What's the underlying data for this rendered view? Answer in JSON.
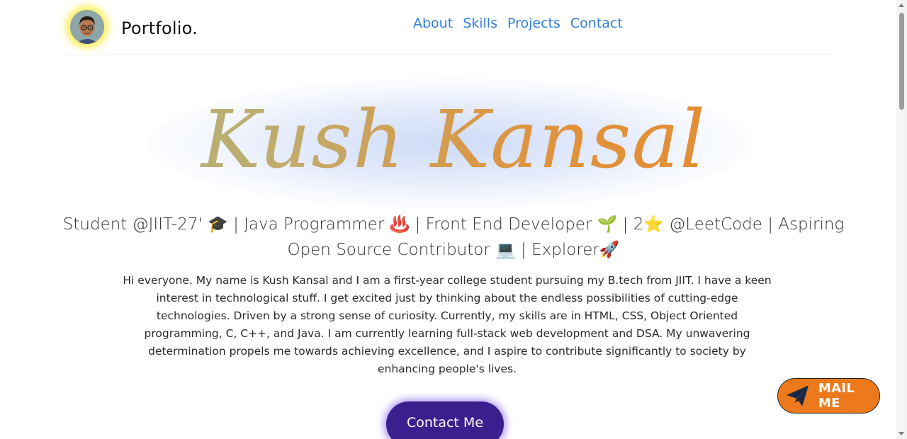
{
  "header": {
    "brand": "Portfolio.",
    "nav": [
      "About",
      "Skills",
      "Projects",
      "Contact"
    ]
  },
  "hero": {
    "name": "Kush Kansal",
    "tagline": "Student @JIIT-27' 🎓 | Java Programmer ♨️ | Front End Developer 🌱 | 2⭐ @LeetCode | Aspiring Open Source Contributor 💻 | Explorer🚀",
    "bio": "Hi everyone. My name is Kush Kansal and I am a first-year college student pursuing my B.tech from JIIT. I have a keen interest in technological stuff. I get excited just by thinking about the endless possibilities of cutting-edge technologies. Driven by a strong sense of curiosity. Currently, my skills are in HTML, CSS, Object Oriented programming, C, C++, and Java. I am currently learning full-stack web development and DSA. My unwavering determination propels me towards achieving excellence, and I aspire to contribute significantly to society by enhancing people's lives.",
    "contact_button": "Contact Me"
  },
  "floating": {
    "mail_button": "MAIL ME",
    "mail_icon": "paper-plane-icon"
  },
  "icons": {
    "avatar": "profile-avatar"
  },
  "colors": {
    "nav_link": "#2f7fd8",
    "contact_button": "#3b1f8f",
    "mail_button": "#ec7a1c",
    "name_gradient_start": "#a6b785",
    "name_gradient_end": "#e6892d"
  }
}
